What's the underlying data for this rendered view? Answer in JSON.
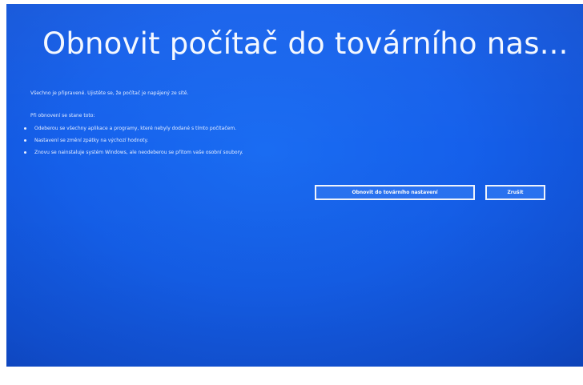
{
  "screen": {
    "title": "Obnovit počítač do továrního nas...",
    "ready_text": "Všechno je připravené. Ujistěte se, že počítač je napájený ze sítě.",
    "reset_intro": "Při obnovení se stane toto:",
    "bullets": [
      "Odeberou se všechny aplikace a programy, které nebyly dodané s tímto počítačem.",
      "Nastavení se změní zpátky na výchozí hodnoty.",
      "Znovu se nainstaluje systém Windows, ale neodeberou se přitom vaše osobní soubory."
    ],
    "buttons": {
      "reset_label": "Obnovit do továrního nastavení",
      "cancel_label": "Zrušit"
    }
  },
  "colors": {
    "background": "#1560eb",
    "text": "#ffffff",
    "button_border": "#f2f6ff"
  }
}
